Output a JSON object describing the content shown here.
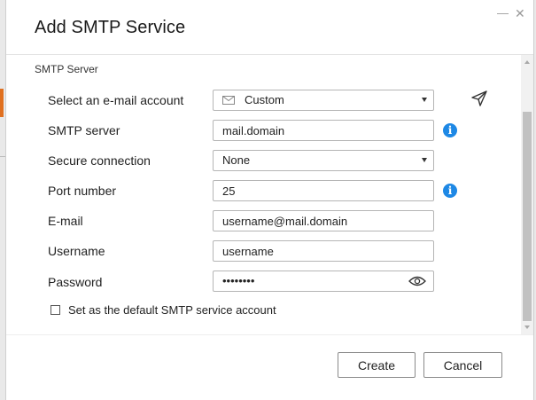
{
  "dialog": {
    "title": "Add SMTP Service",
    "minimize_glyph": "—",
    "close_glyph": "✕"
  },
  "section": {
    "label": "SMTP Server"
  },
  "form": {
    "account": {
      "label": "Select an e-mail account",
      "value": "Custom",
      "icon": "mail-icon"
    },
    "smtp_server": {
      "label": "SMTP server",
      "value": "mail.domain",
      "icon": "info-icon"
    },
    "secure_connection": {
      "label": "Secure connection",
      "value": "None"
    },
    "port": {
      "label": "Port number",
      "value": "25",
      "icon": "info-icon"
    },
    "email": {
      "label": "E-mail",
      "value": "username@mail.domain"
    },
    "username": {
      "label": "Username",
      "value": "username"
    },
    "password": {
      "label": "Password",
      "value": "••••••••",
      "icon": "eye-icon"
    },
    "default_checkbox": {
      "label": "Set as the default SMTP service account",
      "checked": false
    },
    "test_icon": "send-icon"
  },
  "buttons": {
    "create": "Create",
    "cancel": "Cancel"
  },
  "colors": {
    "info_blue": "#1e88e5",
    "background_accent": "#e07020"
  }
}
